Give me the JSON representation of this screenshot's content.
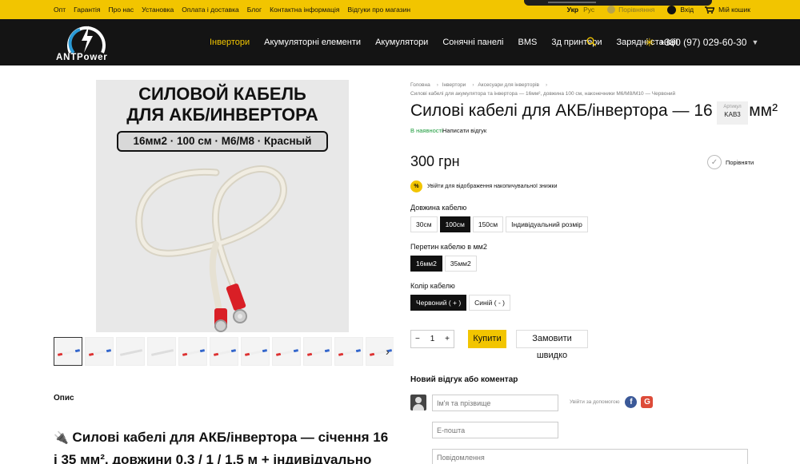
{
  "topbar": {
    "links": [
      "Опт",
      "Гарантія",
      "Про нас",
      "Установка",
      "Оплата і доставка",
      "Блог",
      "Контактна інформація",
      "Відгуки про магазин"
    ],
    "lang_active": "Укр",
    "lang_other": "Рус",
    "compare": "Порівняння",
    "login": "Вхід",
    "cabinet": "Мій кошик"
  },
  "header": {
    "logo_text": "ANTPower",
    "nav": [
      "Інвертори",
      "Акумуляторні елементи",
      "Акумулятори",
      "Сонячні панелі",
      "BMS",
      "3д принтери",
      "Зарядні станції"
    ],
    "phone": "+380 (97) 029-60-30"
  },
  "gallery": {
    "image_title_line1": "СИЛОВОЙ КАБЕЛЬ",
    "image_title_line2": "ДЛЯ АКБ/ИНВЕРТОРА",
    "image_spec": "16мм2 · 100 см · М6/М8 · Красный"
  },
  "description": {
    "label": "Опис",
    "heading": "Силові кабелі для АКБ/інвертора — січення 16 і 35 мм², довжини 0,3 / 1 / 1,5 м + індивідуально"
  },
  "breadcrumbs": {
    "items": [
      "Головна",
      "Інвертори",
      "Аксесуари для інверторів"
    ],
    "current": "Силові кабелі для акумулятора та інвертора — 16мм², довжина 100 см, наконечники М6/М8/М10 — Червоний"
  },
  "product": {
    "title": "Силові кабелі для АКБ/інвертора — 16 і 35 мм²",
    "article_label": "Артикул",
    "article_value": "KAB3",
    "stock": "В наявності",
    "write_review": "Написати відгук",
    "price": "300 грн",
    "compare": "Порівняти",
    "discount_badge": "%",
    "discount_text": "Увійти для відображення накопичувальної знижки"
  },
  "options": {
    "length_label": "Довжина кабелю",
    "length": [
      "30см",
      "100см",
      "150см",
      "Індивідуальний розмір"
    ],
    "section_label": "Перетин кабелю в мм2",
    "section": [
      "16мм2",
      "35мм2"
    ],
    "color_label": "Колір кабелю",
    "color": [
      "Червоний ( + )",
      "Синій ( - )"
    ]
  },
  "purchase": {
    "qty": "1",
    "minus": "−",
    "plus": "+",
    "buy": "Купити",
    "quick_order": "Замовити швидко"
  },
  "review_form": {
    "title": "Новий відгук або коментар",
    "name_placeholder": "Ім'я та прізвище",
    "email_placeholder": "E-пошта",
    "message_placeholder": "Повідомлення",
    "social_login": "Увійти за допомогою",
    "fb": "f",
    "google": "G"
  }
}
